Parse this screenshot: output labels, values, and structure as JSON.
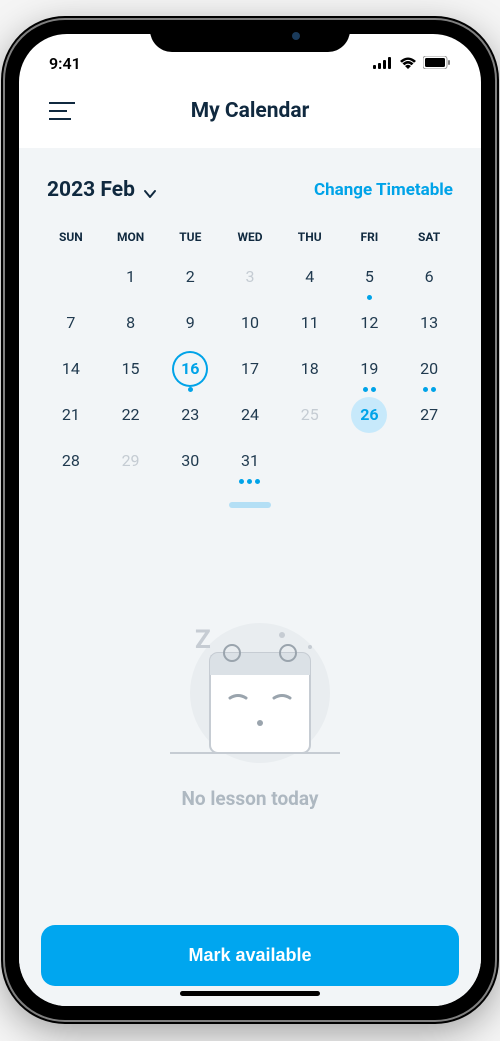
{
  "status": {
    "time": "9:41"
  },
  "header": {
    "title": "My Calendar"
  },
  "month_selector": {
    "label": "2023 Feb"
  },
  "change_timetable": "Change Timetable",
  "weekdays": [
    "SUN",
    "MON",
    "TUE",
    "WED",
    "THU",
    "FRI",
    "SAT"
  ],
  "weeks": [
    [
      {
        "n": "",
        "muted": false,
        "dots": 0
      },
      {
        "n": "1",
        "muted": false,
        "dots": 0
      },
      {
        "n": "2",
        "muted": false,
        "dots": 0
      },
      {
        "n": "3",
        "muted": true,
        "dots": 0
      },
      {
        "n": "4",
        "muted": false,
        "dots": 0
      },
      {
        "n": "5",
        "muted": false,
        "dots": 1
      },
      {
        "n": "6",
        "muted": false,
        "dots": 0
      }
    ],
    [
      {
        "n": "7",
        "muted": false,
        "dots": 0
      },
      {
        "n": "8",
        "muted": false,
        "dots": 0
      },
      {
        "n": "9",
        "muted": false,
        "dots": 0
      },
      {
        "n": "10",
        "muted": false,
        "dots": 0
      },
      {
        "n": "11",
        "muted": false,
        "dots": 0
      },
      {
        "n": "12",
        "muted": false,
        "dots": 0
      },
      {
        "n": "13",
        "muted": false,
        "dots": 0
      }
    ],
    [
      {
        "n": "14",
        "muted": false,
        "dots": 0
      },
      {
        "n": "15",
        "muted": false,
        "dots": 0
      },
      {
        "n": "16",
        "muted": false,
        "dots": 1,
        "outlined": true
      },
      {
        "n": "17",
        "muted": false,
        "dots": 0
      },
      {
        "n": "18",
        "muted": false,
        "dots": 0
      },
      {
        "n": "19",
        "muted": false,
        "dots": 2
      },
      {
        "n": "20",
        "muted": false,
        "dots": 2
      }
    ],
    [
      {
        "n": "21",
        "muted": false,
        "dots": 0
      },
      {
        "n": "22",
        "muted": false,
        "dots": 0
      },
      {
        "n": "23",
        "muted": false,
        "dots": 0
      },
      {
        "n": "24",
        "muted": false,
        "dots": 0
      },
      {
        "n": "25",
        "muted": true,
        "dots": 0
      },
      {
        "n": "26",
        "muted": false,
        "dots": 0,
        "filled": true
      },
      {
        "n": "27",
        "muted": false,
        "dots": 0
      }
    ],
    [
      {
        "n": "28",
        "muted": false,
        "dots": 0
      },
      {
        "n": "29",
        "muted": true,
        "dots": 0
      },
      {
        "n": "30",
        "muted": false,
        "dots": 0
      },
      {
        "n": "31",
        "muted": false,
        "dots": 3
      },
      {
        "n": "",
        "muted": false,
        "dots": 0
      },
      {
        "n": "",
        "muted": false,
        "dots": 0
      },
      {
        "n": "",
        "muted": false,
        "dots": 0
      }
    ]
  ],
  "empty_state": {
    "message": "No lesson today"
  },
  "cta": {
    "label": "Mark available"
  }
}
